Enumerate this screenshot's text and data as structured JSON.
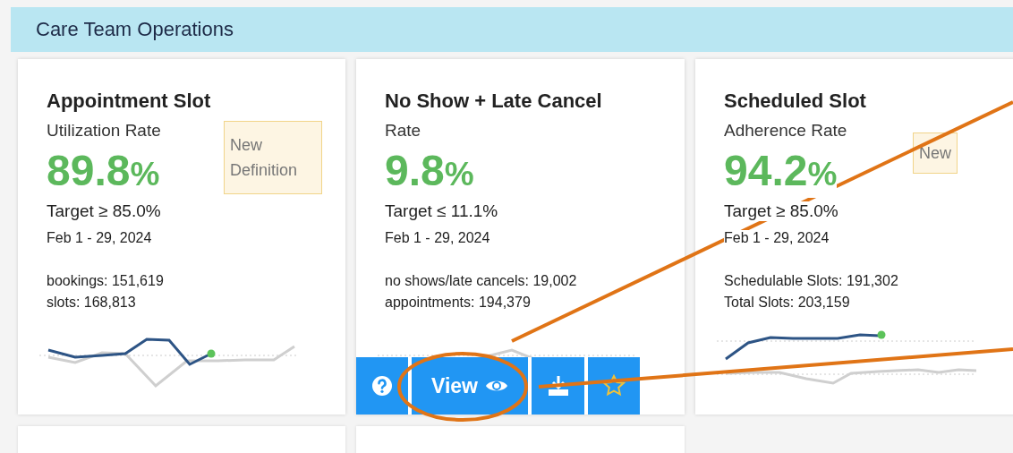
{
  "header": {
    "title": "Care Team Operations"
  },
  "cards": [
    {
      "title": "Appointment Slot",
      "subtitle": "Utilization Rate",
      "value": "89.8",
      "unit": "%",
      "target": "Target ≥ 85.0%",
      "period": "Feb 1 - 29, 2024",
      "stats": [
        "bookings: 151,619",
        "slots: 168,813"
      ],
      "badge": "New Definition"
    },
    {
      "title": "No Show + Late Cancel",
      "subtitle": "Rate",
      "value": "9.8",
      "unit": "%",
      "target": "Target ≤ 11.1%",
      "period": "Feb 1 - 29, 2024",
      "stats": [
        "no shows/late cancels: 19,002",
        "appointments: 194,379"
      ],
      "toolbar": [
        {
          "kind": "help"
        },
        {
          "kind": "view",
          "label": "View"
        },
        {
          "kind": "download"
        },
        {
          "kind": "favorite"
        }
      ]
    },
    {
      "title": "Scheduled Slot",
      "subtitle": "Adherence Rate",
      "value": "94.2",
      "unit": "%",
      "target": "Target ≥ 85.0%",
      "period": "Feb 1 - 29, 2024",
      "stats": [
        "Schedulable Slots: 191,302",
        "Total Slots: 203,159"
      ],
      "badge": "New"
    }
  ]
}
